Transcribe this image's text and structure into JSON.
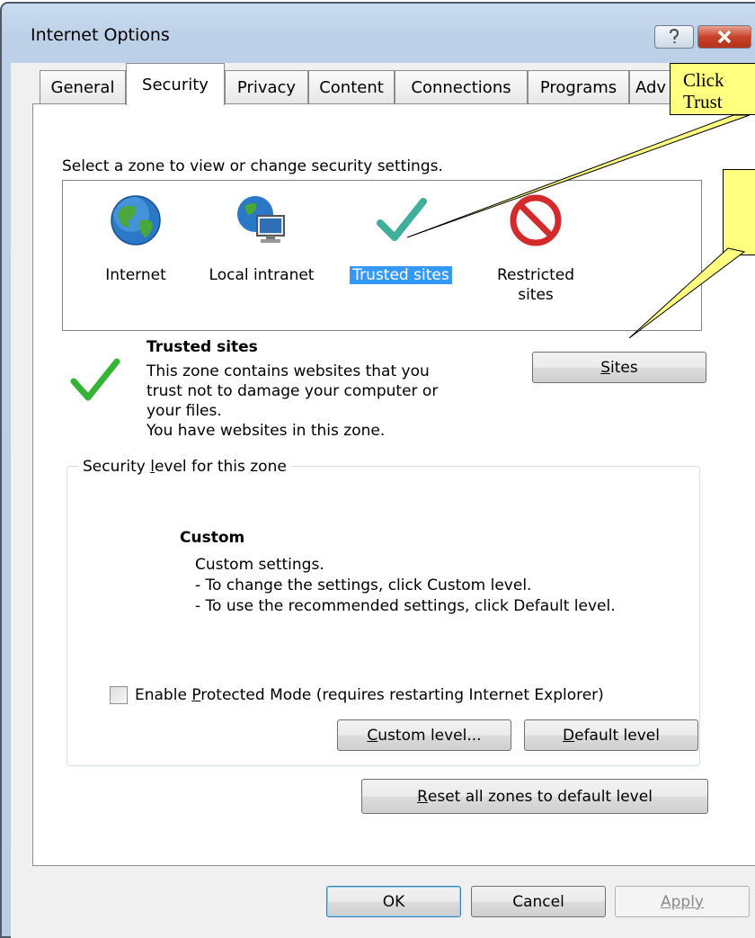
{
  "window": {
    "title": "Internet Options"
  },
  "tabs": [
    "General",
    "Security",
    "Privacy",
    "Content",
    "Connections",
    "Programs",
    "Adv"
  ],
  "zone_prompt": "Select a zone to view or change security settings.",
  "zones": [
    {
      "label": "Internet",
      "icon": "globe-icon"
    },
    {
      "label": "Local intranet",
      "icon": "intranet-icon"
    },
    {
      "label": "Trusted sites",
      "icon": "check-icon",
      "selected": true
    },
    {
      "label_line1": "Restricted",
      "label_line2": "sites",
      "icon": "restricted-icon"
    }
  ],
  "zone_info": {
    "title": "Trusted sites",
    "desc_lines": [
      "This zone contains websites that you",
      "trust not to damage your computer or",
      "your files.",
      "You have websites in this zone."
    ],
    "sites_button": {
      "mnemonic": "S",
      "rest": "ites"
    }
  },
  "security_level": {
    "legend_pre": "Security ",
    "legend_mnemonic": "l",
    "legend_post": "evel for this zone",
    "level_name": "Custom",
    "level_lines": [
      "Custom settings.",
      "- To change the settings, click Custom level.",
      "- To use the recommended settings, click Default level."
    ],
    "protected_mode": {
      "pre": "Enable ",
      "mnemonic": "P",
      "post": "rotected Mode (requires restarting Internet Explorer)",
      "checked": false
    },
    "custom_button": {
      "mnemonic": "C",
      "rest": "ustom level..."
    },
    "default_button": {
      "mnemonic": "D",
      "rest": "efault level"
    }
  },
  "reset_button": {
    "mnemonic": "R",
    "rest": "eset all zones to default level"
  },
  "footer": {
    "ok": "OK",
    "cancel": "Cancel",
    "apply": "Apply"
  },
  "callouts": {
    "first": "Click\nTrust",
    "second": ""
  },
  "colors": {
    "selection": "#3399ff",
    "callout_bg": "#ffff80",
    "close_red": "#c7432a"
  }
}
